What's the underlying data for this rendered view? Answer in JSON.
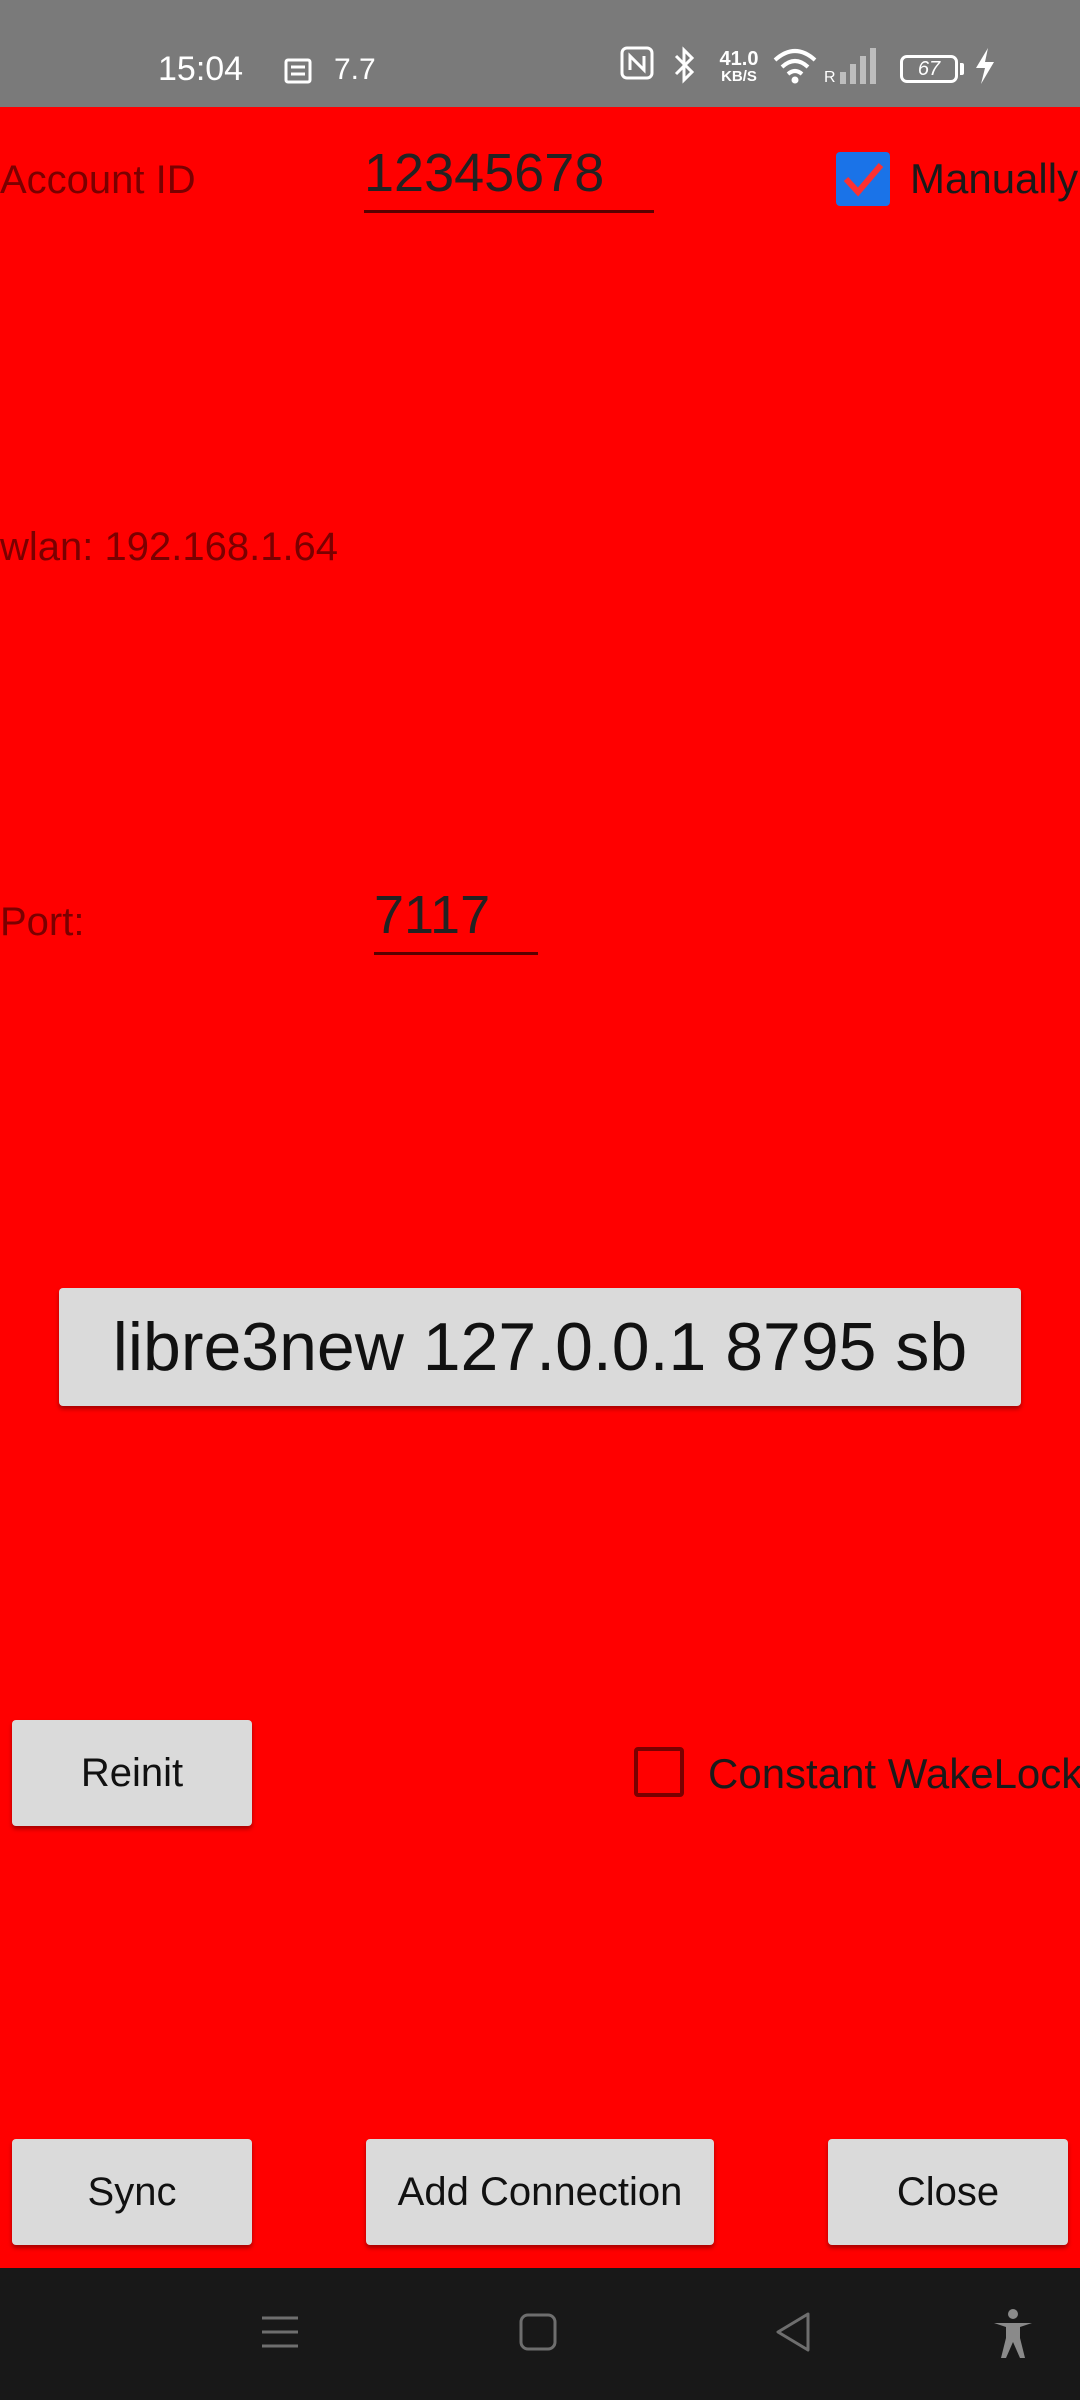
{
  "status_bar": {
    "time": "15:04",
    "notification_icon": "sim-card-icon",
    "notification_text": "7.7",
    "net_speed_value": "41.0",
    "net_speed_unit": "KB/S",
    "battery_level": "67",
    "signal_roaming": "R",
    "icons": [
      "nfc-icon",
      "bluetooth-icon",
      "wifi-icon",
      "signal-icon",
      "battery-icon",
      "charging-icon"
    ]
  },
  "form": {
    "account_id_label": "Account ID",
    "account_id_value": "12345678",
    "manually_label": "Manually",
    "manually_checked": true,
    "wlan_text": "wlan: 192.168.1.64",
    "port_label": "Port:",
    "port_value": "7117",
    "connection_button": "libre3new 127.0.0.1 8795 sb",
    "reinit_button": "Reinit",
    "wakelock_label": "Constant WakeLock",
    "wakelock_checked": false
  },
  "actions": {
    "sync": "Sync",
    "add_connection": "Add Connection",
    "close": "Close"
  },
  "nav_bar": {
    "icons": [
      "menu-icon",
      "home-icon",
      "back-icon",
      "accessibility-icon"
    ]
  },
  "colors": {
    "background": "#ff0000",
    "status_bar": "#7a7a7a",
    "checkbox_accent": "#1a73e8",
    "button": "#dadada",
    "nav_bar": "#181818"
  }
}
